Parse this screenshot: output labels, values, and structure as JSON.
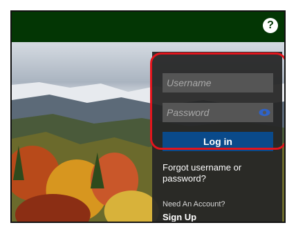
{
  "header": {
    "help_icon": "question-circle-icon",
    "help_label": "?"
  },
  "login": {
    "username_placeholder": "Username",
    "password_placeholder": "Password",
    "show_password_icon": "eye-icon",
    "submit_label": "Log in",
    "forgot_label": "Forgot username or password?",
    "need_account_label": "Need An Account?",
    "signup_label": "Sign Up"
  },
  "colors": {
    "header": "#033604",
    "panel": "#262626",
    "input": "#555555",
    "button": "#0a4a8a",
    "eye_icon": "#2f63c8",
    "highlight": "#e3141c"
  }
}
